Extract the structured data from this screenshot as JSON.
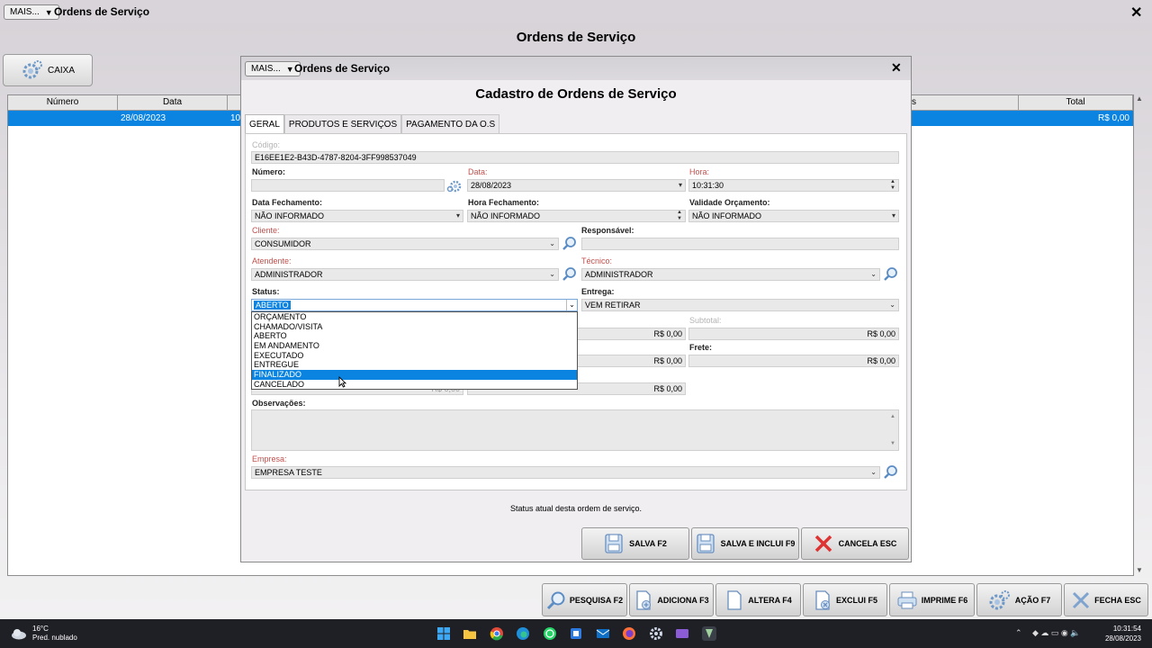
{
  "main": {
    "mais_label": "MAIS...",
    "window_title": "Ordens de Serviço",
    "close": "✕",
    "heading": "Ordens de Serviço",
    "caixa_label": "CAIXA",
    "grid_headers": [
      "Número",
      "Data",
      "s",
      "Total"
    ],
    "row": {
      "data": "28/08/2023",
      "partial": "10",
      "total": "R$ 0,00"
    },
    "scroll_up": "▲",
    "scroll_down": "▼"
  },
  "dialog": {
    "mais_label": "MAIS...",
    "title": "Ordens de Serviço",
    "close": "✕",
    "heading": "Cadastro de Ordens de Serviço",
    "tabs": [
      "GERAL",
      "PRODUTOS E SERVIÇOS",
      "PAGAMENTO DA O.S"
    ],
    "form": {
      "codigo_label": "Código:",
      "codigo_value": "E16EE1E2-B43D-4787-8204-3FF998537049",
      "numero_label": "Número:",
      "numero_value": "",
      "data_label": "Data:",
      "data_value": "28/08/2023",
      "hora_label": "Hora:",
      "hora_value": "10:31:30",
      "data_fech_label": "Data Fechamento:",
      "data_fech_value": "NÃO INFORMADO",
      "hora_fech_label": "Hora Fechamento:",
      "hora_fech_value": "NÃO INFORMADO",
      "validade_label": "Validade Orçamento:",
      "validade_value": "NÃO INFORMADO",
      "cliente_label": "Cliente:",
      "cliente_value": "CONSUMIDOR",
      "responsavel_label": "Responsável:",
      "responsavel_value": "",
      "atendente_label": "Atendente:",
      "atendente_value": "ADMINISTRADOR",
      "tecnico_label": "Técnico:",
      "tecnico_value": "ADMINISTRADOR",
      "status_label": "Status:",
      "status_value": "ABERTO",
      "entrega_label": "Entrega:",
      "entrega_value": "VEM RETIRAR",
      "subtotal_label": "Subtotal:",
      "subtotal_value": "R$ 0,00",
      "frete_label": "Frete:",
      "frete_value": "R$ 0,00",
      "mid_values": [
        "R$ 0,00",
        "R$ 0,00",
        "R$ 0,00"
      ],
      "hidden_partial": "R$ 0,00",
      "obs_label": "Observações:",
      "obs_value": "",
      "empresa_label": "Empresa:",
      "empresa_value": "EMPRESA TESTE"
    },
    "status_options": [
      "ORÇAMENTO",
      "CHAMADO/VISITA",
      "ABERTO",
      "EM ANDAMENTO",
      "EXECUTADO",
      "ENTREGUE",
      "FINALIZADO",
      "CANCELADO"
    ],
    "status_highlighted_index": 6,
    "status_hint": "Status atual desta ordem de serviço.",
    "buttons": {
      "salva": "SALVA F2",
      "salva_inclui": "SALVA E INCLUI F9",
      "cancela": "CANCELA ESC"
    }
  },
  "toolbar": {
    "pesquisa": "PESQUISA F2",
    "adiciona": "ADICIONA F3",
    "altera": "ALTERA F4",
    "exclui": "EXCLUI F5",
    "imprime": "IMPRIME F6",
    "acao": "AÇÃO F7",
    "fecha": "FECHA ESC"
  },
  "taskbar": {
    "temp": "16°C",
    "weather": "Pred. nublado",
    "time": "10:31:54",
    "date": "28/08/2023"
  },
  "colors": {
    "selection": "#0a84e0",
    "required_label": "#c0504d",
    "taskbar": "#1f1f26"
  }
}
